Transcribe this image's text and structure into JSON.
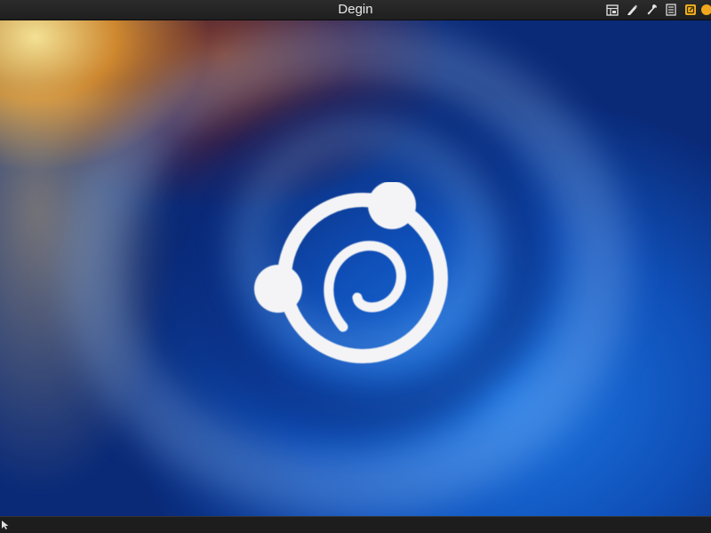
{
  "topbar": {
    "title": "Degin",
    "tray_icons": [
      {
        "name": "window-list-icon"
      },
      {
        "name": "pen-icon"
      },
      {
        "name": "wrench-icon"
      },
      {
        "name": "notes-icon"
      },
      {
        "name": "edit-note-icon"
      },
      {
        "name": "status-dot-icon"
      }
    ]
  },
  "colors": {
    "bar_background": "#222222",
    "title_text": "#e8e8e8",
    "tray_accent": "#f0b020",
    "logo": "#f4f4f6"
  },
  "bottombar": {
    "corner_icon": "cursor-icon"
  }
}
